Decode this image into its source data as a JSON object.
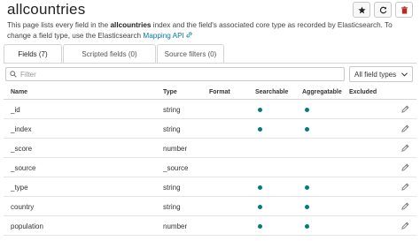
{
  "page": {
    "title": "allcountries",
    "desc_before": "This page lists every field in the ",
    "desc_index": "allcountries",
    "desc_after": " index and the field's associated core type as recorded by Elasticsearch. To change a field type, use the Elasticsearch ",
    "desc_link": "Mapping API"
  },
  "header_buttons": [
    {
      "name": "set-default-button",
      "icon": "star-icon"
    },
    {
      "name": "refresh-button",
      "icon": "refresh-icon"
    },
    {
      "name": "delete-button",
      "icon": "trash-icon",
      "color": "#bd271e"
    }
  ],
  "tabs": [
    {
      "label": "Fields (7)",
      "active": true
    },
    {
      "label": "Scripted fields (0)",
      "active": false
    },
    {
      "label": "Source filters (0)",
      "active": false
    }
  ],
  "filter": {
    "placeholder": "Filter"
  },
  "type_select": {
    "value": "All field types"
  },
  "table": {
    "headers": {
      "name": "Name",
      "type": "Type",
      "format": "Format",
      "searchable": "Searchable",
      "aggregatable": "Aggregatable",
      "excluded": "Excluded"
    },
    "rows": [
      {
        "name": "_id",
        "type": "string",
        "searchable": true,
        "aggregatable": true
      },
      {
        "name": "_index",
        "type": "string",
        "searchable": true,
        "aggregatable": true
      },
      {
        "name": "_score",
        "type": "number",
        "searchable": false,
        "aggregatable": false
      },
      {
        "name": "_source",
        "type": "_source",
        "searchable": false,
        "aggregatable": false
      },
      {
        "name": "_type",
        "type": "string",
        "searchable": true,
        "aggregatable": true
      },
      {
        "name": "country",
        "type": "string",
        "searchable": true,
        "aggregatable": true
      },
      {
        "name": "population",
        "type": "number",
        "searchable": true,
        "aggregatable": true
      }
    ]
  },
  "colors": {
    "dot": "#017d73",
    "link": "#0079a5",
    "danger": "#bd271e"
  }
}
